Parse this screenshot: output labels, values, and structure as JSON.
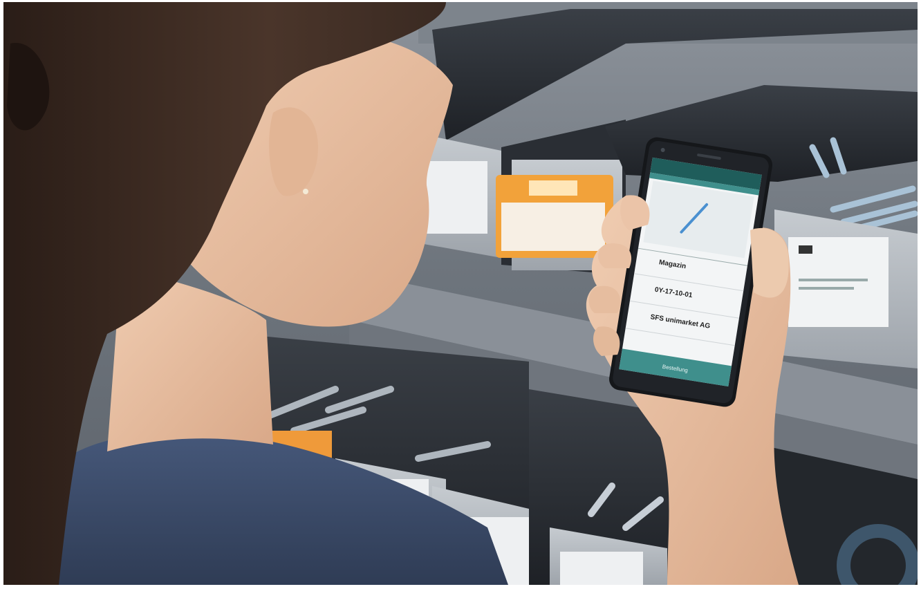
{
  "scene": {
    "colors": {
      "shelf": "#9aa1a8",
      "bin_dark": "#2c3036",
      "bin_gray": "#b9bec4",
      "orange_box": "#f2a23a",
      "shirt": "#3b4a63",
      "hair": "#3a2a22",
      "skin": "#e8c1a5",
      "app_header": "#1f5d5b",
      "app_button": "#3f8f8c"
    }
  },
  "phone_screen": {
    "rows": [
      {
        "label": "Magazin"
      },
      {
        "label": "0Y-17-10-01"
      },
      {
        "label": "SFS unimarket AG"
      }
    ],
    "action_button": "Bestellung"
  }
}
